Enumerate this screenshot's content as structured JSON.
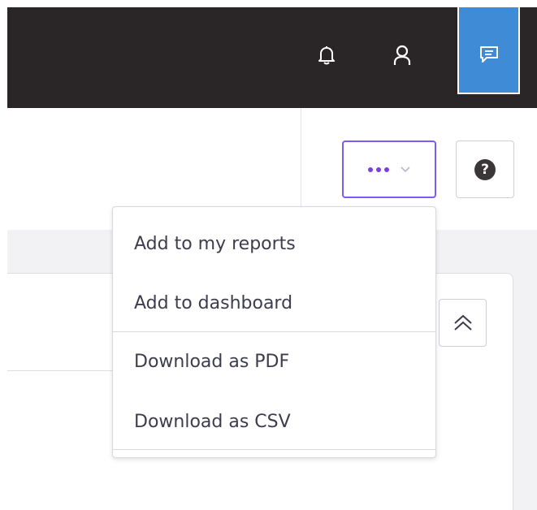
{
  "topbar": {
    "icons": [
      "bell-icon",
      "user-icon",
      "chat-icon"
    ],
    "background": "#2a2526",
    "active_button_color": "#3f8bd6"
  },
  "toolbar": {
    "more_button": {
      "icons": [
        "ellipsis-icon",
        "chevron-down-icon"
      ],
      "accent": "#7a3fe0"
    },
    "help_button": {
      "label": "?"
    }
  },
  "card": {
    "collapse_icon": "double-chevron-up-icon"
  },
  "menu": {
    "items": [
      {
        "label": "Add to my reports"
      },
      {
        "label": "Add to dashboard"
      },
      {
        "label": "Download as PDF"
      },
      {
        "label": "Download as CSV"
      }
    ]
  }
}
